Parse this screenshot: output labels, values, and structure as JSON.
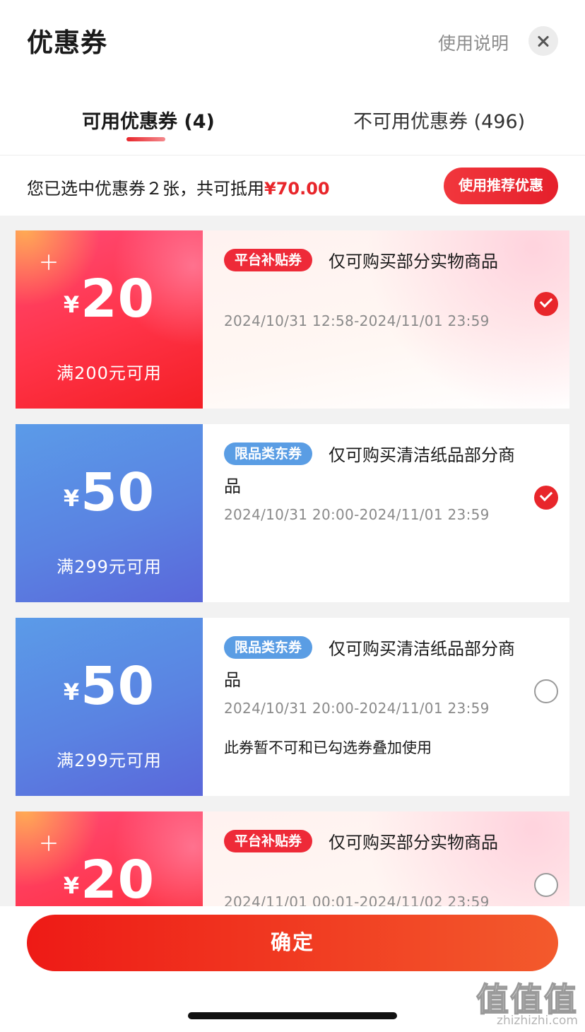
{
  "header": {
    "title": "优惠券",
    "help_link": "使用说明"
  },
  "tabs": {
    "available": "可用优惠券 (4)",
    "unavailable": "不可用优惠券 (496)"
  },
  "summary": {
    "text": "您已选中优惠券２张，共可抵用",
    "amount": "¥70.00",
    "recommend_button": "使用推荐优惠"
  },
  "coupons": [
    {
      "currency": "¥",
      "amount": "20",
      "threshold": "满200元可用",
      "tag": "平台补贴券",
      "description": "仅可购买部分实物商品",
      "validity": "2024/10/31 12:58-2024/11/01 23:59",
      "selected": true
    },
    {
      "currency": "¥",
      "amount": "50",
      "threshold": "满299元可用",
      "tag": "限品类东券",
      "description": "仅可购买清洁纸品部分商品",
      "validity": "2024/10/31 20:00-2024/11/01 23:59",
      "selected": true
    },
    {
      "currency": "¥",
      "amount": "50",
      "threshold": "满299元可用",
      "tag": "限品类东券",
      "description": "仅可购买清洁纸品部分商品",
      "validity": "2024/10/31 20:00-2024/11/01 23:59",
      "note": "此券暂不可和已勾选券叠加使用",
      "selected": false
    },
    {
      "currency": "¥",
      "amount": "20",
      "tag": "平台补贴券",
      "description": "仅可购买部分实物商品",
      "validity": "2024/11/01 00:01-2024/11/02 23:59",
      "selected": false
    }
  ],
  "footer": {
    "confirm_button": "确定"
  },
  "watermark": {
    "logo": "值值值",
    "url": "zhizhizhi.com"
  },
  "colors": {
    "accent_red": "#e8262b",
    "coupon_blue": "#5a83e2"
  }
}
